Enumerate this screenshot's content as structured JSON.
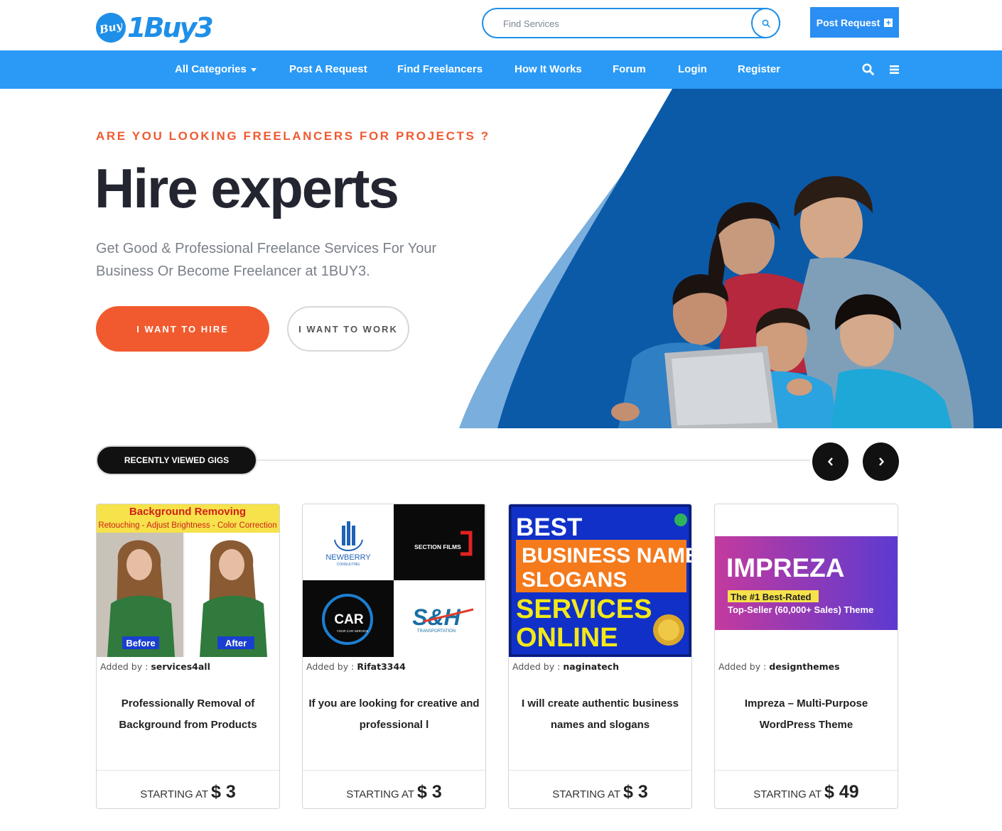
{
  "header": {
    "logo_text": "1Buy3",
    "logo_badge": "Buy",
    "search_placeholder": "Find Services",
    "post_request_label": "Post Request"
  },
  "nav": {
    "items": [
      {
        "label": "All Categories"
      },
      {
        "label": "Post A Request"
      },
      {
        "label": "Find Freelancers"
      },
      {
        "label": "How It Works"
      },
      {
        "label": "Forum"
      },
      {
        "label": "Login"
      },
      {
        "label": "Register"
      }
    ]
  },
  "hero": {
    "eyebrow": "ARE YOU LOOKING FREELANCERS FOR PROJECTS ?",
    "title": "Hire experts",
    "subtitle": "Get Good & Professional Freelance Services For Your Business Or Become Freelancer at 1BUY3.",
    "hire_button": "I WANT TO HIRE",
    "work_button": "I WANT TO WORK"
  },
  "recent": {
    "label": "RECENTLY VIEWED GIGS"
  },
  "gigs": [
    {
      "added_label": "Added by :",
      "author": "services4all",
      "title": "Professionally Removal of Background from Products",
      "starting_label": "STARTING AT",
      "price": "$ 3",
      "img": {
        "headline": "Background Removing",
        "subline": "Retouching - Adjust Brightness - Color Correction",
        "before": "Before",
        "after": "After"
      }
    },
    {
      "added_label": "Added by :",
      "author": "Rifat3344",
      "title": "If you are looking for creative and professional l",
      "starting_label": "STARTING AT",
      "price": "$ 3",
      "img": {
        "logo1": "NEWBERRY",
        "logo1_sub": "CONSULTING",
        "logo2": "SECTION FILMS",
        "logo3": "CAR",
        "logo3_sub": "YOUR CAR SERVICE",
        "logo4": "S&H",
        "logo4_sub": "TRANSPORTATION"
      }
    },
    {
      "added_label": "Added by :",
      "author": "naginatech",
      "title": "I will create authentic business names and slogans",
      "starting_label": "STARTING AT",
      "price": "$ 3",
      "img": {
        "line1": "BEST",
        "line2": "BUSINESS NAMES",
        "line3": "SLOGANS",
        "line4": "SERVICES",
        "line5": "ONLINE"
      }
    },
    {
      "added_label": "Added by :",
      "author": "designthemes",
      "title": "Impreza – Multi-Purpose WordPress Theme",
      "starting_label": "STARTING AT",
      "price": "$ 49",
      "img": {
        "brand": "IMPREZA",
        "badge": "The #1 Best-Rated",
        "tagline": "Top-Seller (60,000+ Sales) Theme"
      }
    }
  ],
  "colors": {
    "brand_blue": "#2a9af6",
    "accent_orange": "#f15a2e",
    "hero_dark_blue": "#0b5aa8",
    "heading_dark": "#232631"
  }
}
